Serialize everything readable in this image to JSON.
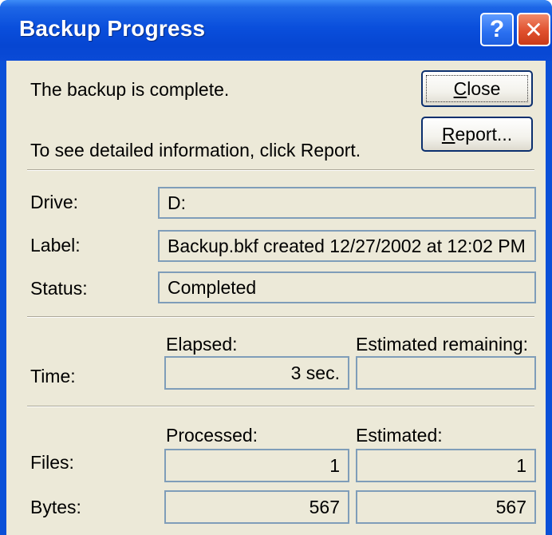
{
  "window": {
    "title": "Backup Progress",
    "help_glyph": "?",
    "close_glyph": "✕"
  },
  "message": {
    "line1": "The backup is complete.",
    "line2": "To see detailed information, click Report."
  },
  "buttons": {
    "close": {
      "underline": "C",
      "rest": "lose"
    },
    "report": {
      "underline": "R",
      "rest": "eport..."
    }
  },
  "info": {
    "drive_label": "Drive:",
    "drive_value": "D:",
    "label_label": "Label:",
    "label_value": "Backup.bkf created 12/27/2002 at 12:02 PM",
    "status_label": "Status:",
    "status_value": "Completed"
  },
  "time": {
    "row_label": "Time:",
    "elapsed_header": "Elapsed:",
    "remaining_header": "Estimated remaining:",
    "elapsed_value": "3 sec.",
    "remaining_value": ""
  },
  "counts": {
    "processed_header": "Processed:",
    "estimated_header": "Estimated:",
    "files_label": "Files:",
    "bytes_label": "Bytes:",
    "files_processed": "1",
    "files_estimated": "1",
    "bytes_processed": "567",
    "bytes_estimated": "567"
  },
  "colors": {
    "titlebar": "#0a4fdc",
    "face": "#ece9d8",
    "field_border": "#7f9db9",
    "close_button": "#e0502e"
  }
}
